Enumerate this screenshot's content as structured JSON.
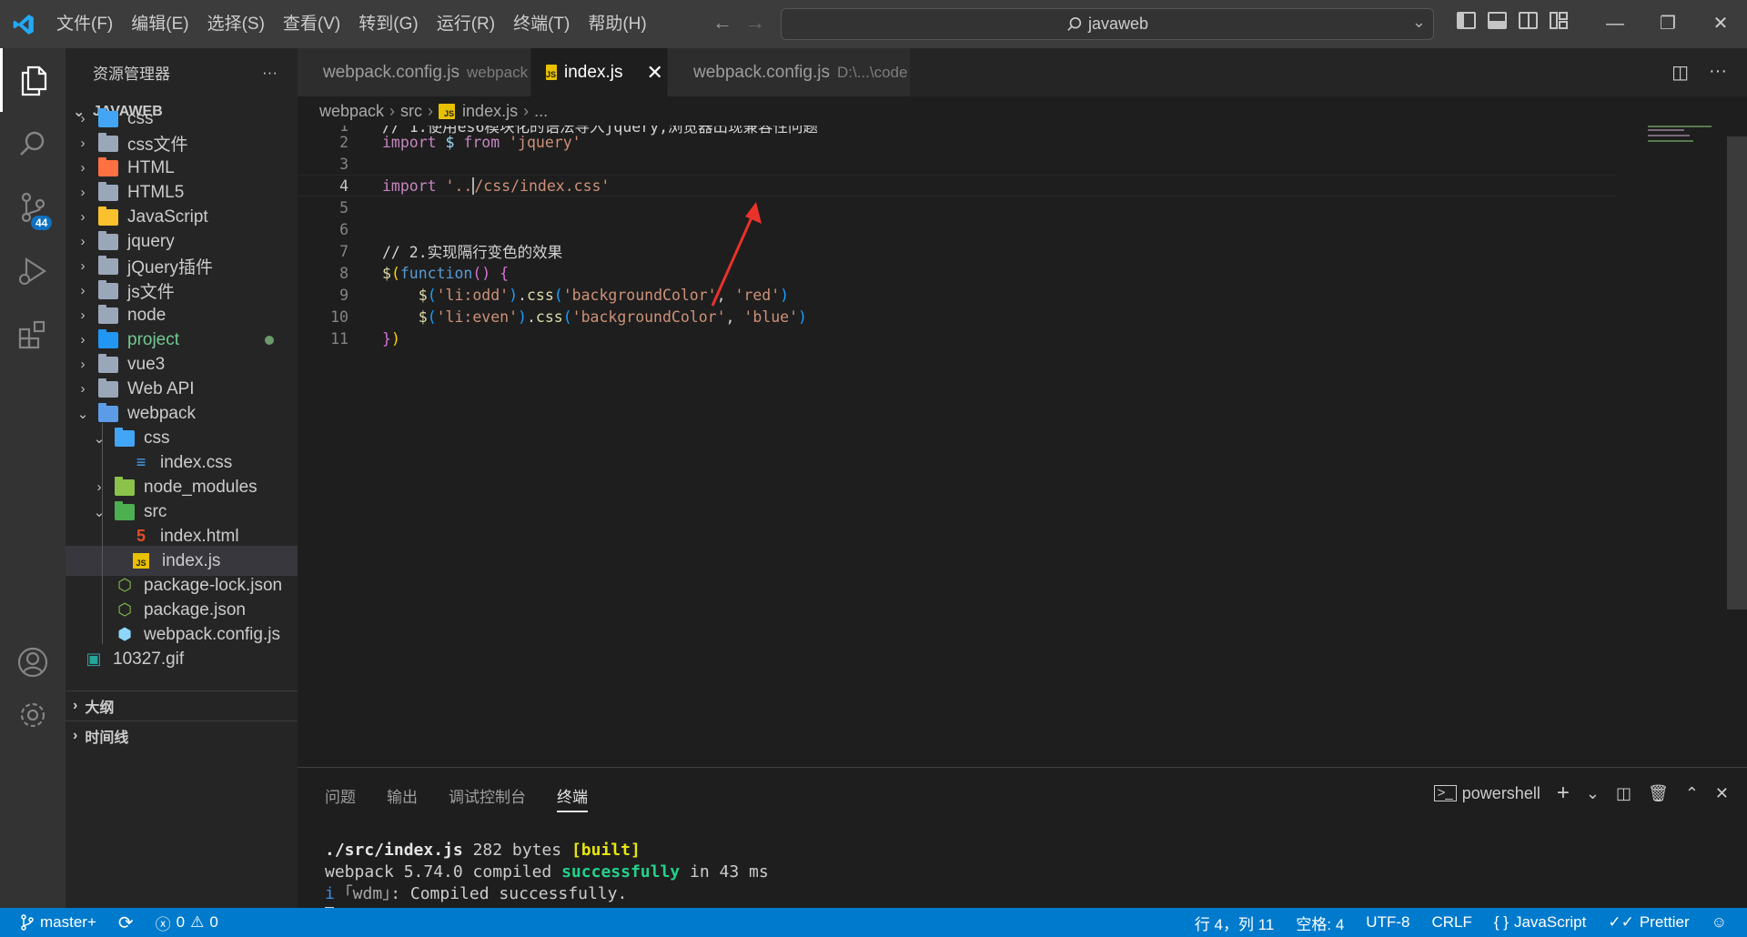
{
  "titlebar": {
    "menu": [
      "文件(F)",
      "编辑(E)",
      "选择(S)",
      "查看(V)",
      "转到(G)",
      "运行(R)",
      "终端(T)",
      "帮助(H)"
    ],
    "search_text": "javaweb"
  },
  "activitybar": {
    "scm_badge": "44"
  },
  "sidebar": {
    "title": "资源管理器",
    "more": "···",
    "workspace": "JAVAWEB",
    "tree": [
      {
        "label": "css",
        "depth": 0,
        "expanded": false
      },
      {
        "label": "css文件",
        "depth": 0,
        "expanded": false
      },
      {
        "label": "HTML",
        "depth": 0,
        "expanded": false
      },
      {
        "label": "HTML5",
        "depth": 0,
        "expanded": false
      },
      {
        "label": "JavaScript",
        "depth": 0,
        "expanded": false
      },
      {
        "label": "jquery",
        "depth": 0,
        "expanded": false
      },
      {
        "label": "jQuery插件",
        "depth": 0,
        "expanded": false
      },
      {
        "label": "js文件",
        "depth": 0,
        "expanded": false
      },
      {
        "label": "node",
        "depth": 0,
        "expanded": false
      },
      {
        "label": "project",
        "depth": 0,
        "expanded": false,
        "modified": true
      },
      {
        "label": "vue3",
        "depth": 0,
        "expanded": false
      },
      {
        "label": "Web API",
        "depth": 0,
        "expanded": false
      },
      {
        "label": "webpack",
        "depth": 0,
        "expanded": true
      },
      {
        "label": "css",
        "depth": 1,
        "expanded": true
      },
      {
        "label": "index.css",
        "depth": 2,
        "file": true
      },
      {
        "label": "node_modules",
        "depth": 1,
        "expanded": false
      },
      {
        "label": "src",
        "depth": 1,
        "expanded": true
      },
      {
        "label": "index.html",
        "depth": 2,
        "file": true
      },
      {
        "label": "index.js",
        "depth": 2,
        "file": true,
        "selected": true
      },
      {
        "label": "package-lock.json",
        "depth": 1,
        "file": true
      },
      {
        "label": "package.json",
        "depth": 1,
        "file": true
      },
      {
        "label": "webpack.config.js",
        "depth": 1,
        "file": true
      },
      {
        "label": "10327.gif",
        "depth": 0,
        "file": true
      }
    ],
    "outline": "大纲",
    "timeline": "时间线"
  },
  "tabs": [
    {
      "label": "webpack.config.js",
      "desc": "webpack",
      "active": false
    },
    {
      "label": "index.js",
      "desc": "",
      "active": true
    },
    {
      "label": "webpack.config.js",
      "desc": "D:\\...\\code",
      "active": false
    }
  ],
  "breadcrumb": [
    "webpack",
    "src",
    "index.js",
    "..."
  ],
  "editor": {
    "line_numbers": [
      "1",
      "2",
      "3",
      "4",
      "5",
      "6",
      "7",
      "8",
      "9",
      "10",
      "11"
    ],
    "line1_comment": "// 1.使用es6模块化的语法导入jquery,浏览器出现兼容性问题",
    "line7_comment": "// 2.实现隔行变色的效果",
    "current_line": 4
  },
  "panel": {
    "tabs": [
      "问题",
      "输出",
      "调试控制台",
      "终端"
    ],
    "active_tab": "终端",
    "shell": "powershell",
    "terminal": {
      "l1_path": "./src/index.js",
      "l1_size": "282 bytes",
      "l1_built": "[built]",
      "l2_pre": "webpack 5.74.0 compiled",
      "l2_success": "successfully",
      "l2_post": "in 43 ms",
      "l3_i": "i",
      "l3_wdm": "｢wdm｣",
      "l3_msg": ": Compiled successfully."
    }
  },
  "statusbar": {
    "branch": "master+",
    "errors": "0",
    "warnings": "0",
    "position": "行 4，列 11",
    "spaces": "空格: 4",
    "encoding": "UTF-8",
    "eol": "CRLF",
    "language": "JavaScript",
    "prettier": "Prettier"
  },
  "colors": {
    "accent": "#007acc",
    "annotation_arrow": "#e8322a"
  }
}
